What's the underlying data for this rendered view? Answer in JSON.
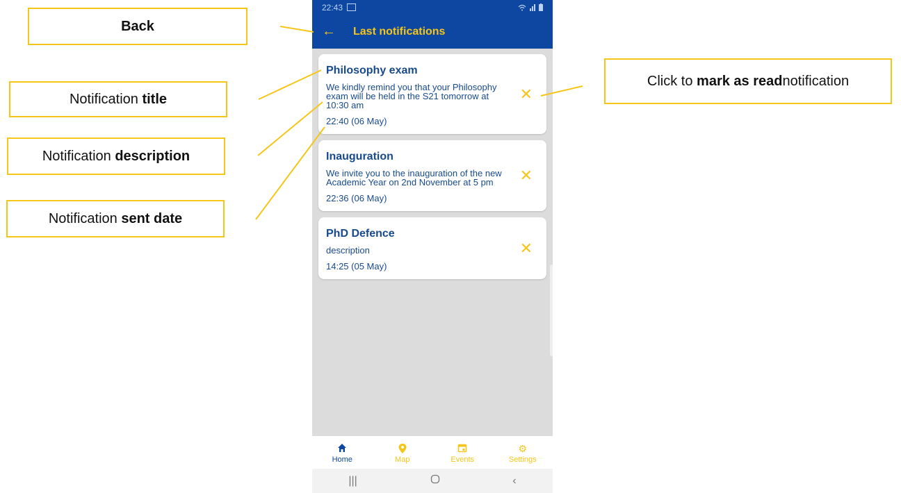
{
  "annotations": {
    "back": "Back",
    "title_prefix": "Notification ",
    "title_bold": "title",
    "desc_prefix": "Notification ",
    "desc_bold": "description",
    "date_prefix": "Notification ",
    "date_bold": "sent date",
    "read_prefix": "Click to ",
    "read_bold": "mark as read",
    "read_suffix": " notification"
  },
  "status_bar": {
    "time": "22:43"
  },
  "app_bar": {
    "title": "Last notifications",
    "back_icon": "←"
  },
  "notifications": [
    {
      "title": "Philosophy exam",
      "description": "We kindly remind you that your Philosophy exam will be held in the S21 tomorrow at 10:30 am",
      "date": "22:40 (06 May)"
    },
    {
      "title": "Inauguration",
      "description": "We invite you to the inauguration of the new Academic Year on 2nd November at 5 pm",
      "date": "22:36 (06 May)"
    },
    {
      "title": "PhD Defence",
      "description": "description",
      "date": "14:25 (05 May)"
    }
  ],
  "bottom_nav": [
    {
      "label": "Home",
      "icon": "home-icon"
    },
    {
      "label": "Map",
      "icon": "map-pin-icon"
    },
    {
      "label": "Events",
      "icon": "calendar-icon"
    },
    {
      "label": "Settings",
      "icon": "gear-icon"
    }
  ],
  "colors": {
    "primary": "#0d47a1",
    "accent": "#f5c518",
    "text": "#174a8c"
  }
}
